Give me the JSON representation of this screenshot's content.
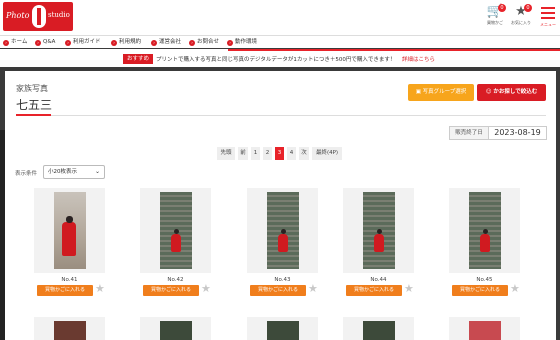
{
  "header": {
    "logo_left": "Photo",
    "logo_right": "studio",
    "cart_label": "買物かご",
    "cart_count": "0",
    "favorite_label": "お気に入り",
    "favorite_count": "0",
    "menu_label": "メニュー"
  },
  "nav": {
    "items": [
      {
        "label": "ホーム"
      },
      {
        "label": "Q&A"
      },
      {
        "label": "利用ガイド"
      },
      {
        "label": "利用規約"
      },
      {
        "label": "運営会社"
      },
      {
        "label": "お問合せ"
      },
      {
        "label": "動作環境"
      }
    ]
  },
  "recommend": {
    "tag": "おすすめ",
    "message": "プリントで購入する写真と同じ写真のデジタルデータが1カットにつき＋500円で購入できます！",
    "link": "詳細はこちら"
  },
  "page": {
    "category": "家族写真",
    "title": "七五三",
    "group_button": "写真グループ選択",
    "apply_button": "かお探しで絞込む",
    "end_label": "販売終了日",
    "end_date": "2023-08-19"
  },
  "pager": {
    "items": [
      "先頭",
      "前",
      "1",
      "2",
      "3",
      "4",
      "次",
      "最終(4P)"
    ],
    "current": "3"
  },
  "display": {
    "label": "表示条件",
    "selected": "小20枚表示"
  },
  "photos": [
    {
      "no": "No.41",
      "cart_label": "買物かごに入れる"
    },
    {
      "no": "No.42",
      "cart_label": "買物かごに入れる"
    },
    {
      "no": "No.43",
      "cart_label": "買物かごに入れる"
    },
    {
      "no": "No.44",
      "cart_label": "買物かごに入れる"
    },
    {
      "no": "No.45",
      "cart_label": "買物かごに入れる"
    }
  ],
  "colors": {
    "brand_red": "#d91c24",
    "cart_orange": "#f07e1c",
    "group_yellow": "#f7a51c"
  }
}
